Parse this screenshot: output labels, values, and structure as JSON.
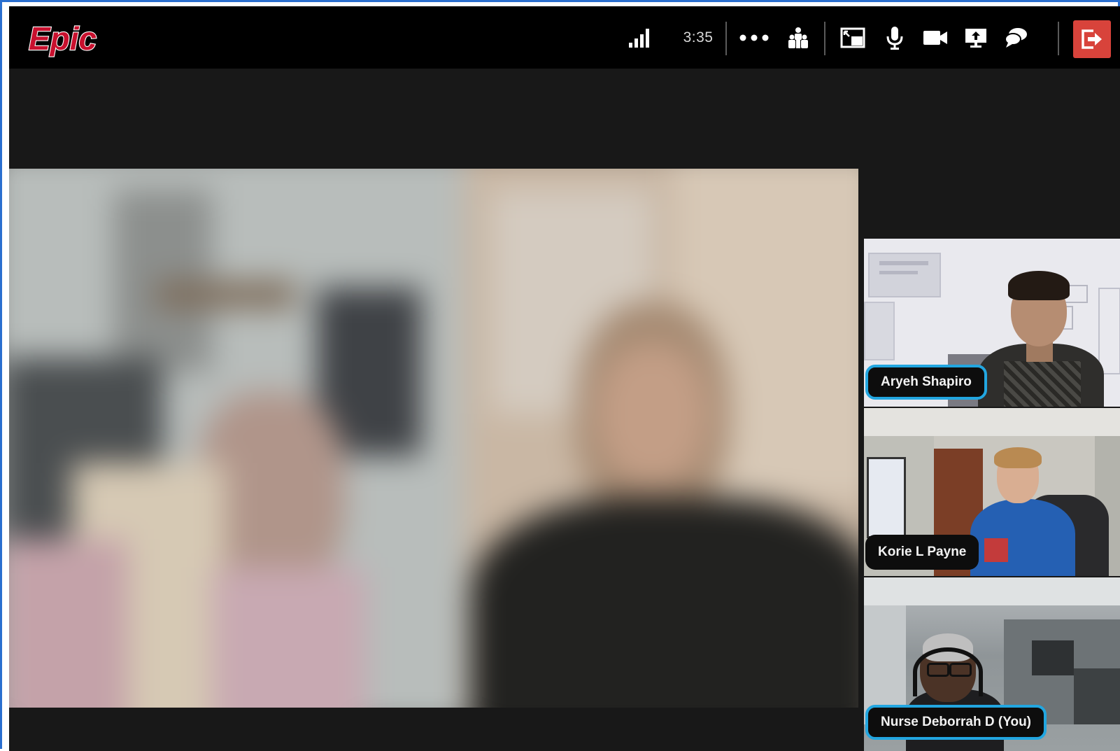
{
  "app": {
    "logo_text": "Epic"
  },
  "toolbar": {
    "timer": "3:35",
    "icons": [
      "signal-strength-icon",
      "more-options-icon",
      "participants-icon",
      "layout-icon",
      "microphone-icon",
      "camera-icon",
      "share-screen-icon",
      "chat-icon",
      "leave-call-icon"
    ]
  },
  "participants": [
    {
      "name": "Aryeh Shapiro",
      "active_speaker": true
    },
    {
      "name": "Korie L Payne",
      "active_speaker": false
    },
    {
      "name": "Nurse Deborrah D (You)",
      "active_speaker": true
    }
  ],
  "colors": {
    "leave": "#d8433b",
    "active_border": "#22a6e0",
    "frame": "#2a6fcf",
    "logo": "#c8102e"
  }
}
